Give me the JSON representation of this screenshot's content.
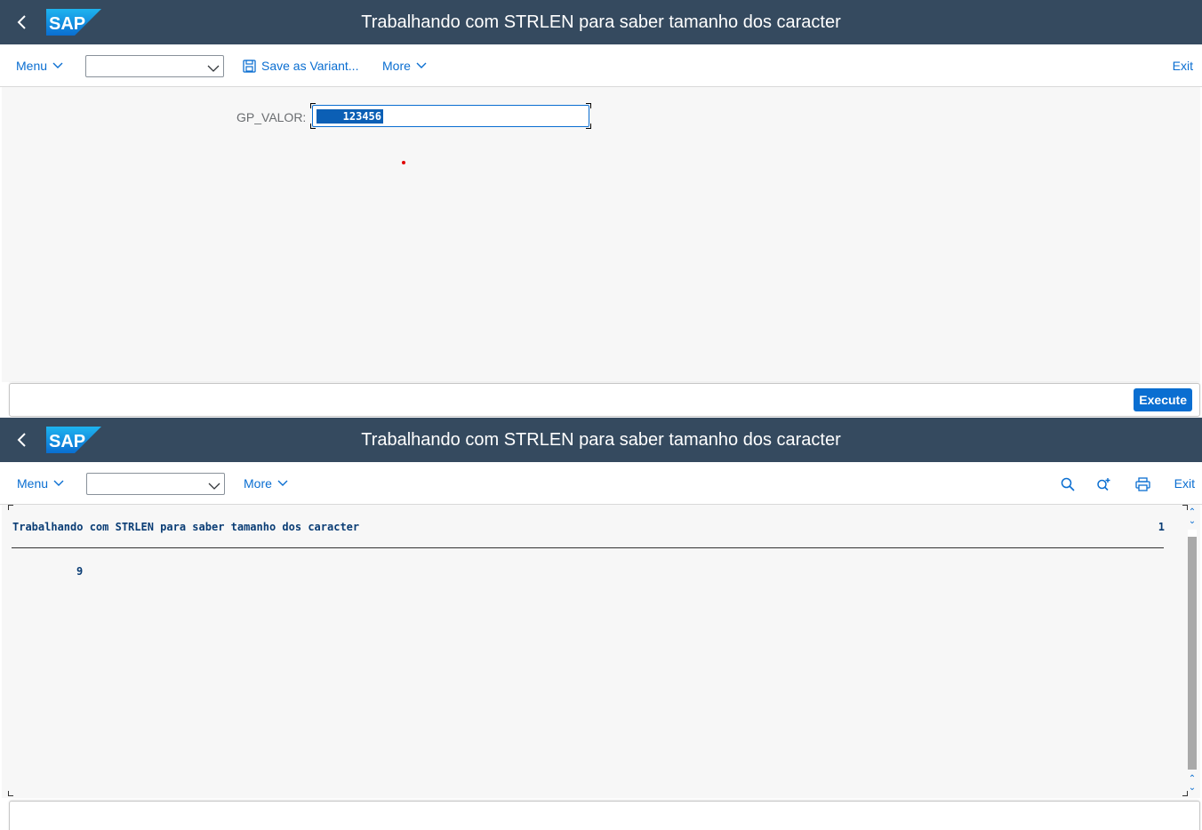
{
  "selection_screen": {
    "title": "Trabalhando com STRLEN para saber tamanho dos caracter",
    "toolbar": {
      "menu_label": "Menu",
      "variant_select_value": "",
      "save_variant_label": "Save as Variant...",
      "more_label": "More",
      "exit_label": "Exit"
    },
    "field": {
      "label": "GP_VALOR:",
      "value": "123456"
    },
    "footer": {
      "execute_label": "Execute"
    }
  },
  "output_screen": {
    "title": "Trabalhando com STRLEN para saber tamanho dos caracter",
    "toolbar": {
      "menu_label": "Menu",
      "variant_select_value": "",
      "more_label": "More",
      "exit_label": "Exit",
      "icons": [
        "search-icon",
        "search-next-icon",
        "print-icon"
      ]
    },
    "list": {
      "header": "Trabalhando com STRLEN para saber tamanho dos caracter",
      "page_number": "1",
      "result_value": "9"
    }
  },
  "colors": {
    "shell": "#354a5f",
    "accent": "#0a6ed1",
    "list_text": "#0a3d75"
  }
}
